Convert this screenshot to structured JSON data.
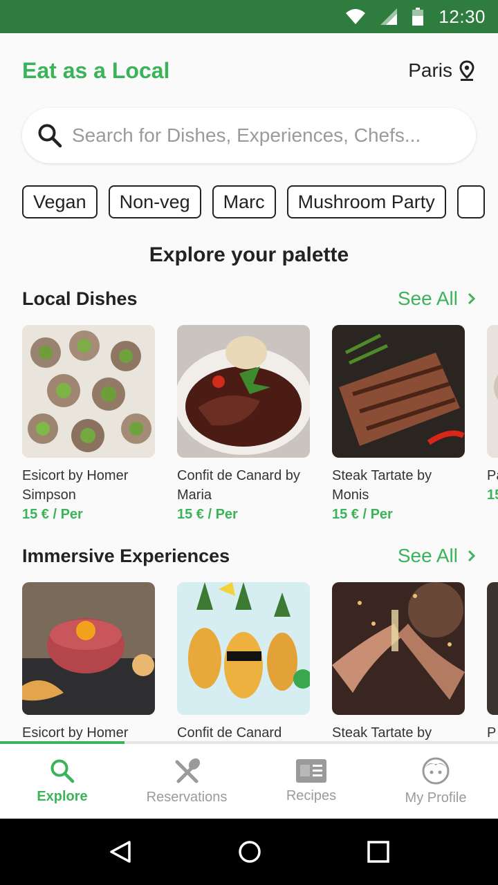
{
  "status_bar": {
    "time": "12:30",
    "icons": [
      "wifi-icon",
      "signal-icon",
      "battery-icon"
    ]
  },
  "header": {
    "brand": "Eat as a Local",
    "location": "Paris"
  },
  "search": {
    "placeholder": "Search for Dishes, Experiences, Chefs..."
  },
  "filters": [
    "Vegan",
    "Non-veg",
    "Marc",
    "Mushroom Party",
    ""
  ],
  "section_title": "Explore your palette",
  "local_dishes": {
    "title": "Local Dishes",
    "see_all": "See All",
    "items": [
      {
        "name": "Esicort by Homer Simpson",
        "price": "15 € / Per",
        "image": "escargots-photo"
      },
      {
        "name": "Confit de Canard by Maria",
        "price": "15 € / Per",
        "image": "duck-confit-photo"
      },
      {
        "name": "Steak Tartate by Monis",
        "price": "15 € / Per",
        "image": "steak-photo"
      },
      {
        "name": "Pa",
        "price": "15",
        "image": "dish-photo"
      }
    ]
  },
  "experiences": {
    "title": "Immersive Experiences",
    "see_all": "See All",
    "items": [
      {
        "name": "Esicort by Homer",
        "image": "tartare-photo"
      },
      {
        "name": "Confit de Canard",
        "image": "pineapple-party-photo"
      },
      {
        "name": "Steak Tartate by",
        "image": "celebration-toast-photo"
      },
      {
        "name": "P",
        "image": "experience-photo"
      }
    ]
  },
  "scroll_progress": 0.25,
  "bottom_nav": [
    {
      "label": "Explore",
      "icon": "search-icon",
      "active": true
    },
    {
      "label": "Reservations",
      "icon": "fork-spoon-icon",
      "active": false
    },
    {
      "label": "Recipes",
      "icon": "book-icon",
      "active": false
    },
    {
      "label": "My Profile",
      "icon": "profile-face-icon",
      "active": false
    }
  ],
  "system_nav": [
    "back-icon",
    "home-icon",
    "recents-icon"
  ],
  "colors": {
    "brand_green": "#3bb35a",
    "status_bar": "#2e7d3e"
  }
}
